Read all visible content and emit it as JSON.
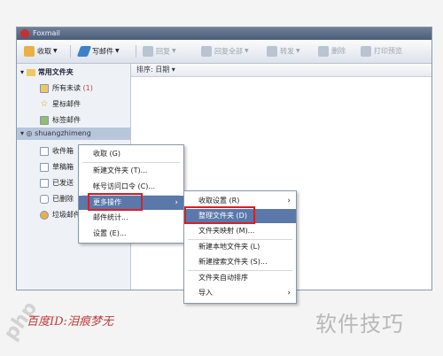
{
  "window": {
    "title": "Foxmail"
  },
  "toolbar": {
    "receive": "收取",
    "compose": "写邮件",
    "reply": "回复",
    "reply_all": "回复全部",
    "forward": "转发",
    "delete": "删除",
    "print": "打印预览"
  },
  "sidebar": {
    "common_folders": "常用文件夹",
    "items": [
      {
        "label": "所有未读",
        "count": "(1)"
      },
      {
        "label": "星标邮件"
      },
      {
        "label": "标签邮件"
      }
    ],
    "account": "shuangzhimeng",
    "account_folders": [
      "收件箱",
      "草稿箱",
      "已发送",
      "已删除",
      "垃圾邮件"
    ]
  },
  "list": {
    "sort_label": "排序: 日期 ▾"
  },
  "context_menu": {
    "items": [
      "收取 (G)",
      "新建文件夹 (T)...",
      "帐号访问口令 (C)...",
      "更多操作",
      "邮件统计...",
      "设置 (E)..."
    ]
  },
  "submenu": {
    "items": [
      "收取设置 (R)",
      "整理文件夹 (D)",
      "文件夹映射 (M)...",
      "新建本地文件夹 (L)",
      "新建搜索文件夹 (S)...",
      "文件夹自动排序",
      "导入"
    ]
  },
  "watermarks": {
    "left": "百度ID:泪痕梦无",
    "right": "软件技巧",
    "php": "php"
  },
  "colors": {
    "highlight": "#5a78aa",
    "red_box": "#d81f26"
  }
}
